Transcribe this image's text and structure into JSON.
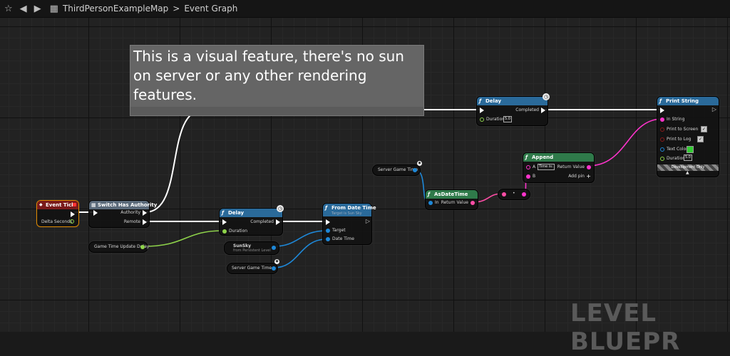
{
  "toolbar": {
    "map_name": "ThirdPersonExampleMap",
    "separator": ">",
    "graph_name": "Event Graph"
  },
  "comment": {
    "text": "This is a visual feature, there's no sun on server or any other rendering features."
  },
  "nodes": {
    "event_tick": {
      "title": "Event Tick",
      "delta_seconds": "Delta Seconds"
    },
    "switch_authority": {
      "title": "Switch Has Authority",
      "authority": "Authority",
      "remote": "Remote"
    },
    "game_time_delay": {
      "title": "Game Time Update Delay"
    },
    "delay_bottom": {
      "title": "Delay",
      "completed": "Completed",
      "duration": "Duration"
    },
    "sunsky": {
      "title": "SunSky",
      "subtitle": "from Persistent Level"
    },
    "server_game_time_bottom": {
      "title": "Server Game Time"
    },
    "from_date_time": {
      "title": "From Date Time",
      "subtitle": "Target is Sun Sky",
      "target": "Target",
      "date_time": "Date Time"
    },
    "delay_top": {
      "title": "Delay",
      "completed": "Completed",
      "duration": "Duration",
      "duration_value": "5.0"
    },
    "server_game_time_top": {
      "title": "Server Game Time"
    },
    "as_date_time": {
      "title": "AsDateTime",
      "in": "In",
      "return_value": "Return Value"
    },
    "append": {
      "title": "Append",
      "a": "A",
      "a_value": "Time is:",
      "b": "B",
      "return_value": "Return Value",
      "add_pin": "Add pin",
      "add_pin_icon": "+"
    },
    "print_string": {
      "title": "Print String",
      "in_string": "In String",
      "print_to_screen": "Print to Screen",
      "print_to_log": "Print to Log",
      "text_color": "Text Color",
      "duration": "Duration",
      "duration_value": "5.0",
      "dev_only": "Development Only",
      "text_color_hex": "#33cc33"
    }
  },
  "watermark": "LEVEL BLUEPR",
  "colors": {
    "exec": "#ffffff",
    "float_pin": "#a0e040",
    "object_pin": "#1e88d8",
    "string_pin": "#ff33cc",
    "struct_pin": "#ff4d94"
  }
}
